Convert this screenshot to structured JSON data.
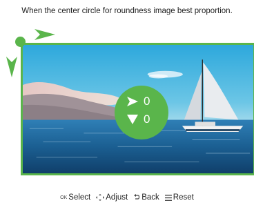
{
  "instruction": "When the center circle for roundness image best proportion.",
  "center_circle": {
    "horizontal_value": "0",
    "vertical_value": "0"
  },
  "footer": {
    "select": {
      "key": "OK",
      "label": "Select"
    },
    "adjust": {
      "label": "Adjust",
      "icon": "dpad-icon"
    },
    "back": {
      "label": "Back",
      "icon": "return-icon"
    },
    "reset": {
      "label": "Reset",
      "icon": "menu-icon"
    }
  },
  "colors": {
    "accent": "#5ab54b",
    "text": "#222222"
  }
}
